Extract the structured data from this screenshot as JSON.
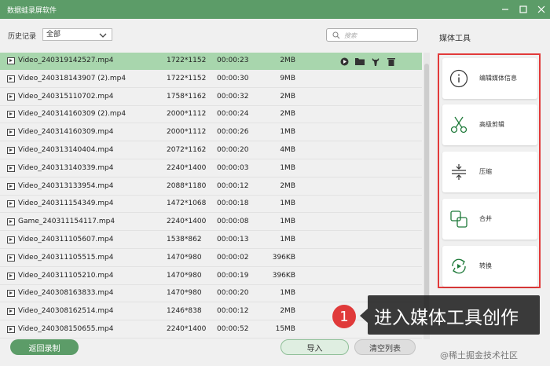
{
  "app": {
    "title": "数据蛙录屏软件"
  },
  "filter": {
    "history_label": "历史记录",
    "history_value": "全部",
    "search_placeholder": "搜索"
  },
  "files": [
    {
      "name": "Video_240319142527.mp4",
      "resolution": "1722*1152",
      "duration": "00:00:23",
      "size": "2MB",
      "selected": true
    },
    {
      "name": "Video_240318143907 (2).mp4",
      "resolution": "1722*1152",
      "duration": "00:00:30",
      "size": "9MB"
    },
    {
      "name": "Video_240315110702.mp4",
      "resolution": "1758*1162",
      "duration": "00:00:32",
      "size": "2MB"
    },
    {
      "name": "Video_240314160309 (2).mp4",
      "resolution": "2000*1112",
      "duration": "00:00:24",
      "size": "2MB"
    },
    {
      "name": "Video_240314160309.mp4",
      "resolution": "2000*1112",
      "duration": "00:00:26",
      "size": "1MB"
    },
    {
      "name": "Video_240313140404.mp4",
      "resolution": "2072*1162",
      "duration": "00:00:20",
      "size": "4MB"
    },
    {
      "name": "Video_240313140339.mp4",
      "resolution": "2240*1400",
      "duration": "00:00:03",
      "size": "1MB"
    },
    {
      "name": "Video_240313133954.mp4",
      "resolution": "2088*1180",
      "duration": "00:00:12",
      "size": "2MB"
    },
    {
      "name": "Video_240311154349.mp4",
      "resolution": "1472*1068",
      "duration": "00:00:18",
      "size": "1MB"
    },
    {
      "name": "Game_240311154117.mp4",
      "resolution": "2240*1400",
      "duration": "00:00:08",
      "size": "1MB"
    },
    {
      "name": "Video_240311105607.mp4",
      "resolution": "1538*862",
      "duration": "00:00:13",
      "size": "1MB"
    },
    {
      "name": "Video_240311105515.mp4",
      "resolution": "1470*980",
      "duration": "00:00:02",
      "size": "396KB"
    },
    {
      "name": "Video_240311105210.mp4",
      "resolution": "1470*980",
      "duration": "00:00:19",
      "size": "396KB"
    },
    {
      "name": "Video_240308163833.mp4",
      "resolution": "1470*980",
      "duration": "00:00:20",
      "size": "1MB"
    },
    {
      "name": "Video_240308162514.mp4",
      "resolution": "1246*838",
      "duration": "00:00:12",
      "size": "2MB"
    },
    {
      "name": "Video_240308150655.mp4",
      "resolution": "2240*1400",
      "duration": "00:00:52",
      "size": "15MB"
    }
  ],
  "buttons": {
    "back": "返回录制",
    "import": "导入",
    "clear": "清空列表"
  },
  "media_tools": {
    "title": "媒体工具",
    "items": [
      {
        "label": "编辑媒体信息",
        "icon": "info-icon"
      },
      {
        "label": "高级剪辑",
        "icon": "scissors-icon"
      },
      {
        "label": "压缩",
        "icon": "compress-icon"
      },
      {
        "label": "合并",
        "icon": "merge-icon"
      },
      {
        "label": "转换",
        "icon": "convert-icon"
      }
    ]
  },
  "callout": {
    "step": "1",
    "text": "进入媒体工具创作"
  },
  "watermark": "@稀土掘金技术社区",
  "colors": {
    "accent": "#5c9c68",
    "selected_row": "#a8d6ad",
    "highlight_border": "#e23a3a"
  }
}
